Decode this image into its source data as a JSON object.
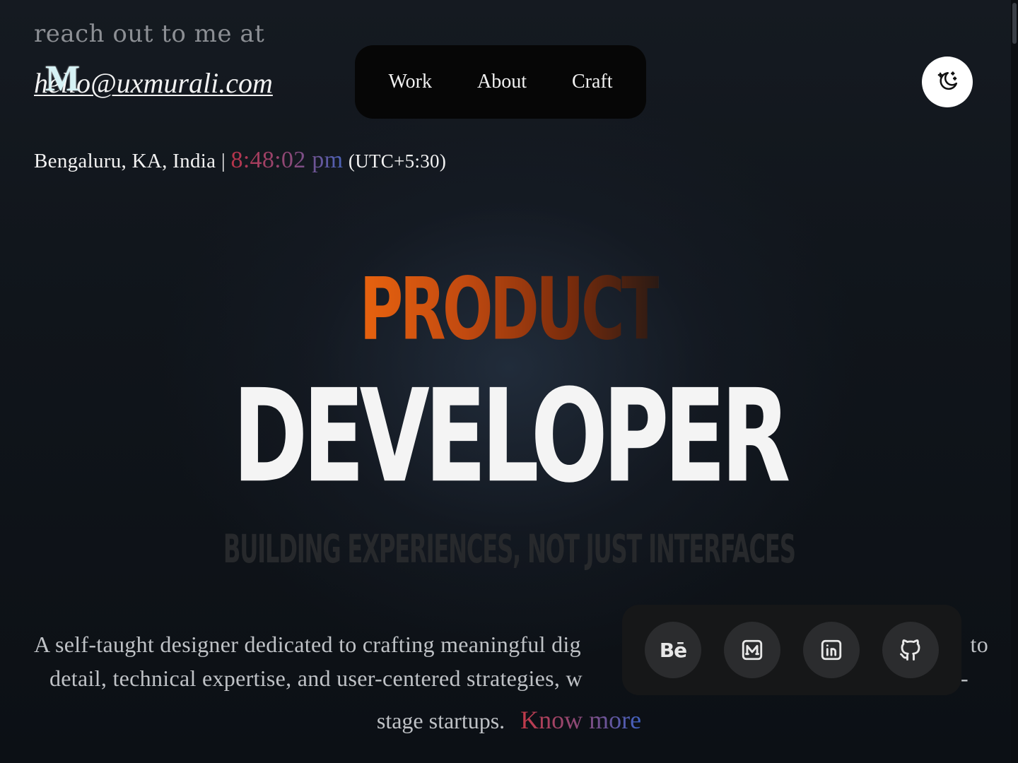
{
  "contact": {
    "reach_text": "reach out to me at",
    "email": "hello@uxmurali.com",
    "logo_letter": "M"
  },
  "nav": {
    "items": [
      {
        "label": "Work"
      },
      {
        "label": "About"
      },
      {
        "label": "Craft"
      }
    ]
  },
  "theme_toggle": {
    "icon": "moon-stars-icon"
  },
  "location": {
    "place": "Bengaluru, KA, India",
    "separator": "|",
    "time": "8:48:02 pm",
    "timezone": "(UTC+5:30)"
  },
  "hero": {
    "line1": "PRODUCT",
    "line2": "DEVELOPER",
    "tagline": "BUILDING EXPERIENCES, NOT JUST INTERFACES"
  },
  "description": {
    "line1": "A self-taught designer dedicated to crafting meaningful dig",
    "line1_end": "to",
    "line2": "detail, technical expertise, and user-centered strategies, w",
    "line2_end": "-",
    "line3": "stage startups.",
    "link": "Know more"
  },
  "social": {
    "items": [
      {
        "icon": "behance-icon",
        "glyph": "Bē"
      },
      {
        "icon": "medium-icon"
      },
      {
        "icon": "linkedin-icon"
      },
      {
        "icon": "github-icon"
      }
    ]
  },
  "colors": {
    "background": "#0d1116",
    "nav_bg": "#060606",
    "product_orange": "#e8630f",
    "time_red": "#b8344a",
    "time_blue": "#4a62b8"
  }
}
